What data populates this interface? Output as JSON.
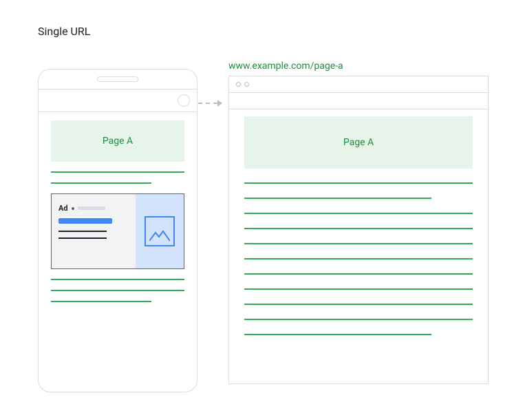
{
  "title": "Single URL",
  "url": "www.example.com/page-a",
  "mobile": {
    "page_title": "Page A",
    "ad_label": "Ad"
  },
  "desktop": {
    "page_title": "Page A"
  }
}
